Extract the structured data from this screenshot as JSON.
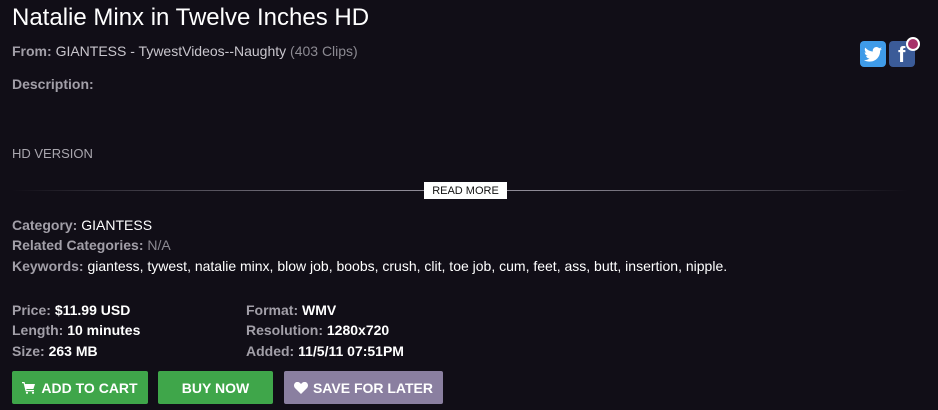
{
  "title": "Natalie Minx in Twelve Inches HD",
  "from": {
    "label": "From:",
    "studio": "GIANTESS - TywestVideos--Naughty",
    "clips": "(403 Clips)"
  },
  "description": {
    "label": "Description:",
    "text": "HD VERSION",
    "read_more": "READ MORE"
  },
  "category": {
    "label": "Category:",
    "value": "GIANTESS"
  },
  "related": {
    "label": "Related Categories:",
    "value": "N/A"
  },
  "keywords": {
    "label": "Keywords:",
    "value": "giantess, tywest, natalie minx, blow job, boobs, crush, clit, toe job, cum, feet, ass, butt, insertion, nipple."
  },
  "specs": {
    "price": {
      "label": "Price:",
      "value": "$11.99 USD"
    },
    "length": {
      "label": "Length:",
      "value": "10 minutes"
    },
    "size": {
      "label": "Size:",
      "value": "263 MB"
    },
    "format": {
      "label": "Format:",
      "value": "WMV"
    },
    "resolution": {
      "label": "Resolution:",
      "value": "1280x720"
    },
    "added": {
      "label": "Added:",
      "value": "11/5/11 07:51PM"
    }
  },
  "buttons": {
    "add_to_cart": "ADD TO CART",
    "buy_now": "BUY NOW",
    "save_for_later": "SAVE FOR LATER"
  },
  "share": {
    "icons": [
      "twitter-icon",
      "facebook-icon"
    ]
  },
  "colors": {
    "background": "#110e17",
    "green": "#3fa64a",
    "purple": "#8a7fa0",
    "label": "#a29fa8"
  }
}
